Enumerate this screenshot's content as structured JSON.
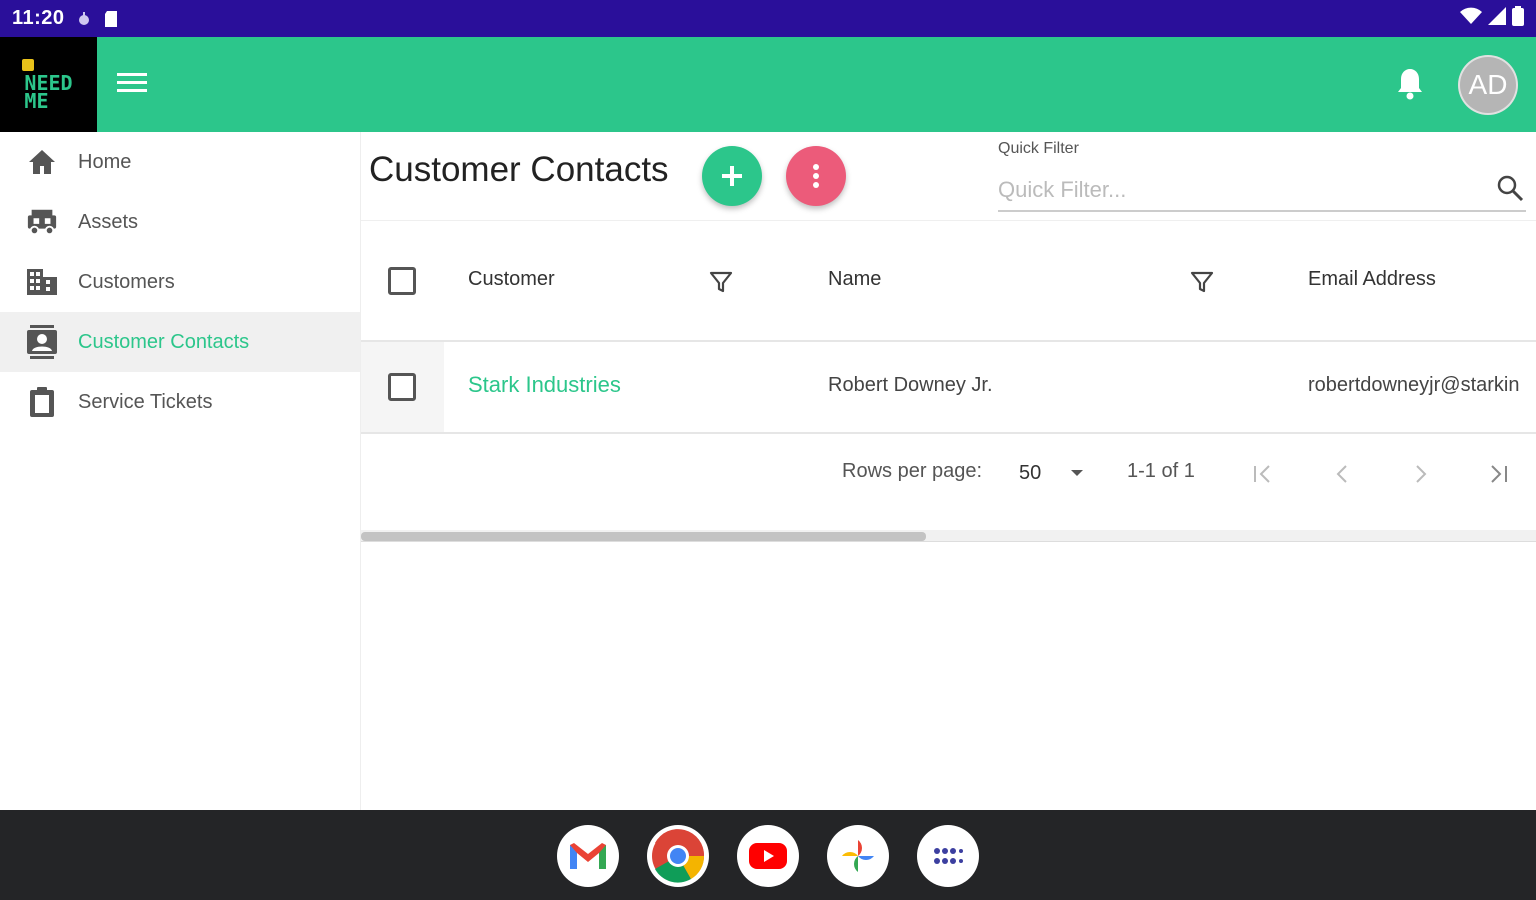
{
  "status_bar": {
    "time": "11:20"
  },
  "header": {
    "avatar_initials": "AD",
    "logo_line1": "NEED",
    "logo_line2": "ME"
  },
  "sidebar": {
    "items": [
      {
        "label": "Home",
        "icon": "home-icon",
        "active": false
      },
      {
        "label": "Assets",
        "icon": "assets-icon",
        "active": false
      },
      {
        "label": "Customers",
        "icon": "building-icon",
        "active": false
      },
      {
        "label": "Customer Contacts",
        "icon": "contact-card-icon",
        "active": true
      },
      {
        "label": "Service Tickets",
        "icon": "clipboard-icon",
        "active": false
      }
    ]
  },
  "main": {
    "title": "Customer Contacts",
    "quick_filter": {
      "label": "Quick Filter",
      "placeholder": "Quick Filter..."
    }
  },
  "table": {
    "columns": [
      "Customer",
      "Name",
      "Email Address"
    ],
    "rows": [
      {
        "customer": "Stark Industries",
        "name": "Robert Downey Jr.",
        "email": "robertdowneyjr@starkin"
      }
    ]
  },
  "pagination": {
    "rows_per_page_label": "Rows per page:",
    "rows_per_page": "50",
    "range": "1-1 of 1"
  },
  "taskbar": {
    "apps": [
      "Gmail",
      "Chrome",
      "YouTube",
      "Photos",
      "App Launcher"
    ]
  },
  "colors": {
    "status_bar": "#2a0f9a",
    "brand_green": "#2cc68b",
    "accent_pink": "#ec5b7a",
    "taskbar": "#242527"
  }
}
